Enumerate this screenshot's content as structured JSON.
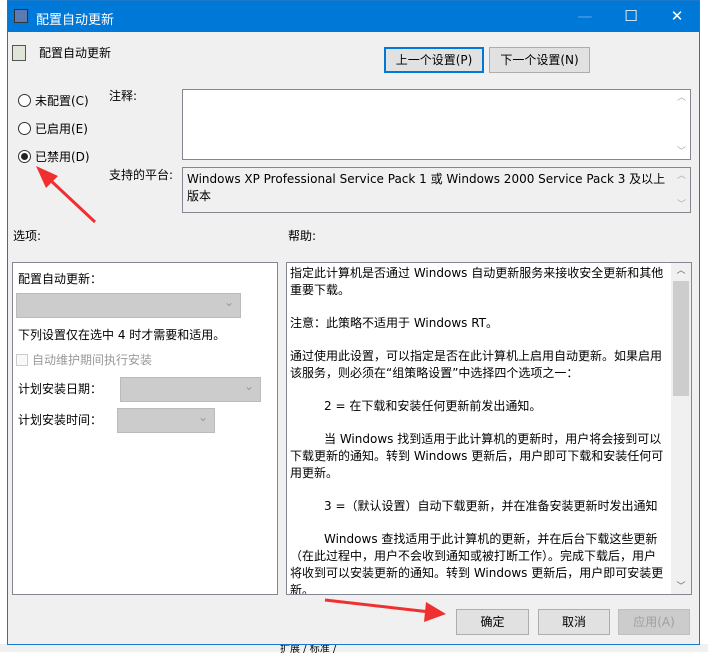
{
  "window": {
    "title": "配置自动更新",
    "maximize": "☐",
    "close": "✕",
    "minimize": "—"
  },
  "header": {
    "title": "配置自动更新",
    "prev_button": "上一个设置(P)",
    "next_button": "下一个设置(N)"
  },
  "state": {
    "options": [
      {
        "label": "未配置(C)",
        "selected": false
      },
      {
        "label": "已启用(E)",
        "selected": false
      },
      {
        "label": "已禁用(D)",
        "selected": true
      }
    ]
  },
  "comment": {
    "label": "注释:",
    "value": ""
  },
  "platform": {
    "label": "支持的平台:",
    "value": "Windows XP Professional Service Pack 1 或 Windows 2000 Service Pack 3 及以上版本"
  },
  "options_panel": {
    "label": "选项:",
    "configure_label": "配置自动更新：",
    "note": "下列设置仅在选中 4 时才需要和适用。",
    "maintenance_checkbox": "自动维护期间执行安装",
    "day_label": "计划安装日期：",
    "time_label": "计划安装时间："
  },
  "help": {
    "label": "帮助:",
    "paragraphs": [
      "指定此计算机是否通过 Windows 自动更新服务来接收安全更新和其他重要下载。",
      "注意：此策略不适用于 Windows RT。",
      "通过使用此设置，可以指定是否在此计算机上启用自动更新。如果启用该服务，则必须在“组策略设置”中选择四个选项之一：",
      "2 = 在下载和安装任何更新前发出通知。",
      "当 Windows 找到适用于此计算机的更新时，用户将会接到可以下载更新的通知。转到 Windows 更新后，用户即可下载和安装任何可用更新。",
      "3 =（默认设置）自动下载更新，并在准备安装更新时发出通知",
      "Windows 查找适用于此计算机的更新，并在后台下载这些更新（在此过程中，用户不会收到通知或被打断工作）。完成下载后，用户将收到可以安装更新的通知。转到 Windows 更新后，用户即可安装更新。"
    ]
  },
  "footer": {
    "ok": "确定",
    "cancel": "取消",
    "apply": "应用(A)"
  },
  "background": {
    "tab_text": "扩展 / 标准 /"
  },
  "colors": {
    "titlebar": "#0078d7",
    "arrow": "#f03030"
  }
}
